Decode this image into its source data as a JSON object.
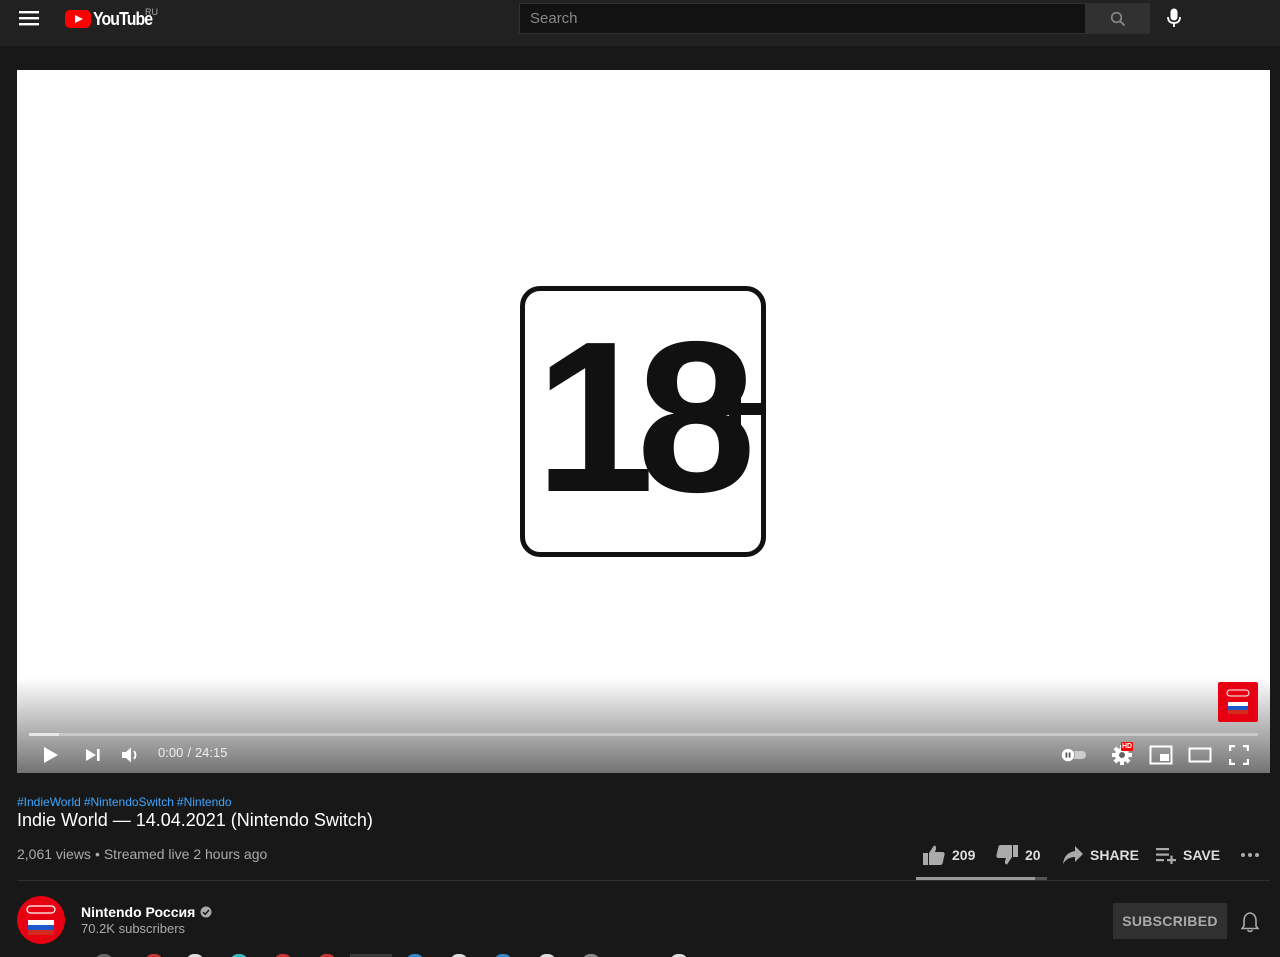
{
  "masthead": {
    "logo_text": "YouTube",
    "region": "RU",
    "search_placeholder": "Search"
  },
  "player": {
    "rating_label": "18",
    "current_time": "0:00",
    "duration": "24:15",
    "progress": 0,
    "quality_badge": "HD"
  },
  "video": {
    "hashtags": [
      "#IndieWorld",
      "#NintendoSwitch",
      "#Nintendo"
    ],
    "title": "Indie World — 14.04.2021 (Nintendo Switch)",
    "views": "2,061 views",
    "streamed": "Streamed live 2 hours ago",
    "likes": "209",
    "dislikes": "20",
    "like_ratio": 0.91,
    "share_label": "SHARE",
    "save_label": "SAVE"
  },
  "channel": {
    "name": "Nintendo Россия",
    "subscribers": "70.2K subscribers",
    "subscribed_label": "SUBSCRIBED",
    "logo_text": "Nintendo"
  },
  "colors": {
    "background": "#181818",
    "masthead": "#212121",
    "brand_red": "#ff0000",
    "nintendo_red": "#e60012",
    "link_blue": "#3ea6ff"
  }
}
